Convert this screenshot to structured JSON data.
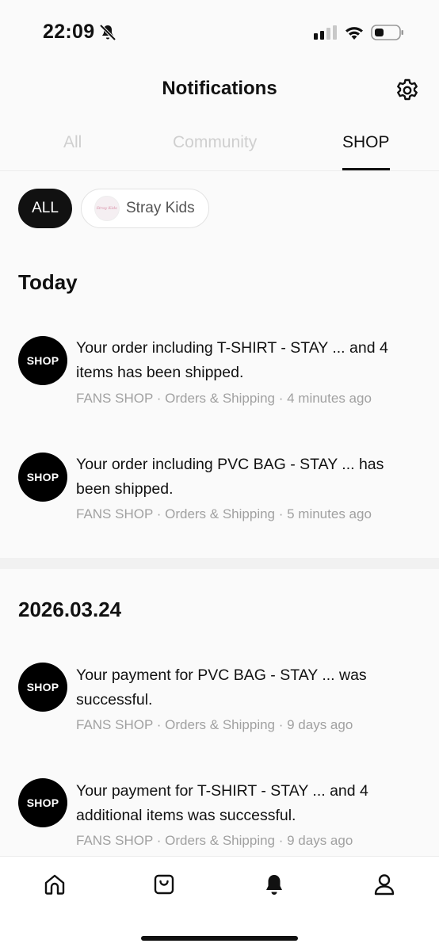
{
  "status_bar": {
    "time": "22:09",
    "icons": [
      "bell-slash-icon",
      "cellular-signal-icon",
      "wifi-icon",
      "battery-icon"
    ]
  },
  "header": {
    "title": "Notifications",
    "settings_icon": "gear-icon"
  },
  "tabs": [
    {
      "label": "All",
      "active": false
    },
    {
      "label": "Community",
      "active": false
    },
    {
      "label": "SHOP",
      "active": true
    }
  ],
  "filters": [
    {
      "label": "ALL",
      "selected": true
    },
    {
      "label": "Stray Kids",
      "selected": false,
      "avatar_text": "Stray Kids"
    }
  ],
  "sections": [
    {
      "title": "Today",
      "items": [
        {
          "icon_label": "SHOP",
          "text": "Your order including T-SHIRT - STAY ... and 4 items has been shipped.",
          "meta": "FANS SHOP · Orders & Shipping · 4 minutes ago"
        },
        {
          "icon_label": "SHOP",
          "text": "Your order including PVC BAG - STAY ... has been shipped.",
          "meta": "FANS SHOP · Orders & Shipping · 5 minutes ago"
        }
      ]
    },
    {
      "title": "2026.03.24",
      "items": [
        {
          "icon_label": "SHOP",
          "text": "Your payment for PVC BAG - STAY ... was successful.",
          "meta": "FANS SHOP · Orders & Shipping · 9 days ago"
        },
        {
          "icon_label": "SHOP",
          "text": "Your payment for T-SHIRT - STAY ... and 4 additional items was successful.",
          "meta": "FANS SHOP · Orders & Shipping · 9 days ago"
        }
      ]
    }
  ],
  "bottom_nav": [
    {
      "icon": "home-icon",
      "active": false
    },
    {
      "icon": "shopping-bag-icon",
      "active": false
    },
    {
      "icon": "bell-icon",
      "active": true
    },
    {
      "icon": "profile-icon",
      "active": false
    }
  ],
  "colors": {
    "text": "#111111",
    "muted": "#a1a1a1",
    "inactive_tab": "#cfcfcf",
    "background": "#fafafa",
    "icon_bg": "#000000"
  }
}
